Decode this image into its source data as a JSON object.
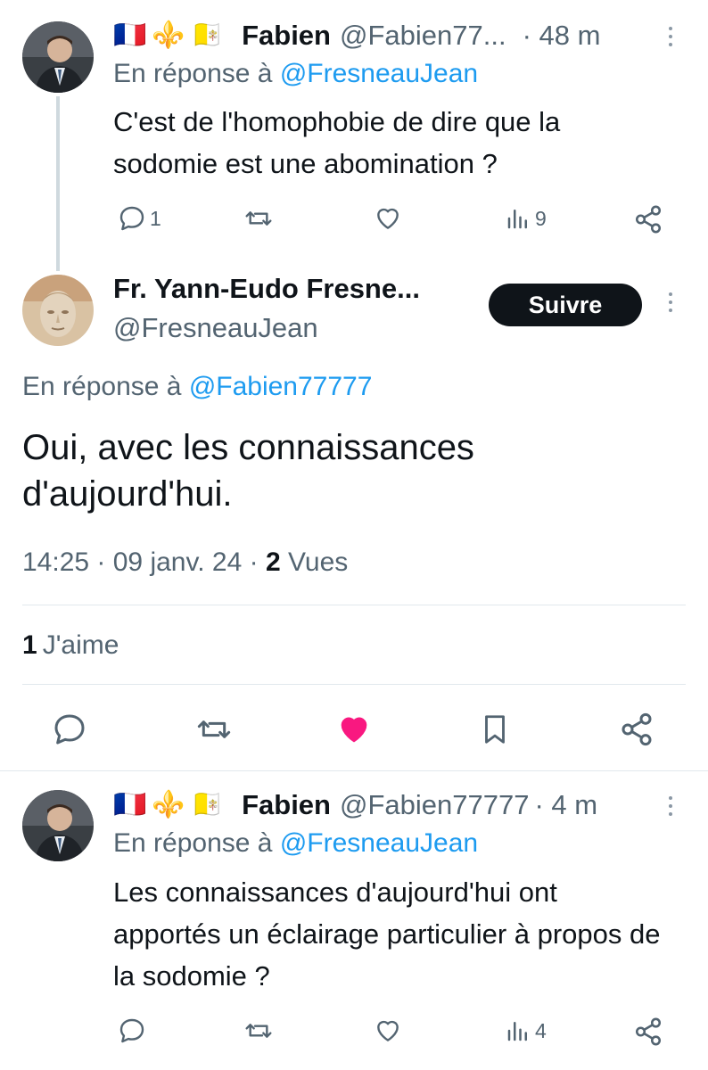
{
  "replies_above": [
    {
      "author_name": "Fabien",
      "author_handle": "@Fabien77...",
      "time": "· 48 m",
      "reply_label": "En réponse à",
      "reply_to": "@FresneauJean",
      "text": "C'est de l'homophobie de dire que la sodomie est une abomination ?",
      "reply_count": "1",
      "views_count": "9",
      "flags": [
        "🇫🇷",
        "⚜️",
        "🇻🇦"
      ]
    }
  ],
  "main_tweet": {
    "author_name": "Fr. Yann-Eudo Fresne...",
    "author_handle": "@FresneauJean",
    "follow_label": "Suivre",
    "reply_label": "En réponse à",
    "reply_to": "@Fabien77777",
    "text": "Oui, avec les connaissances d'aujourd'hui.",
    "time": "14:25",
    "date": "09 janv. 24",
    "views_count": "2",
    "views_label": "Vues",
    "likes_count": "1",
    "likes_label": "J'aime",
    "liked": true,
    "like_color": "#f91880"
  },
  "replies_below": [
    {
      "author_name": "Fabien",
      "author_handle": "@Fabien77777",
      "time": "· 4 m",
      "reply_label": "En réponse à",
      "reply_to": "@FresneauJean",
      "text": "Les connaissances d'aujourd'hui ont apportés un éclairage particulier à propos de la sodomie ?",
      "views_count": "4",
      "flags": [
        "🇫🇷",
        "⚜️",
        "🇻🇦"
      ]
    }
  ],
  "colors": {
    "link": "#1d9bf0",
    "secondary_text": "#536471",
    "divider": "#e1e8ed"
  }
}
